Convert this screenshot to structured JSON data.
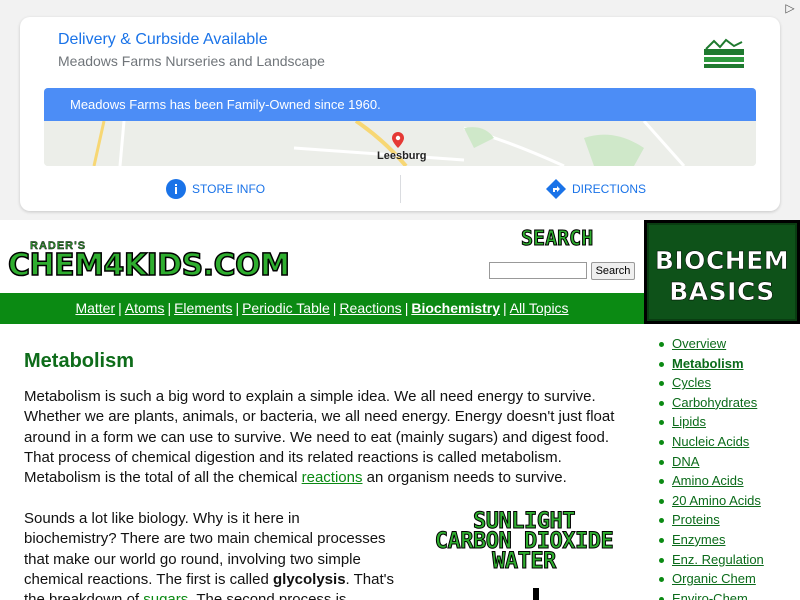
{
  "ad": {
    "close_label": "▷",
    "headline": "Delivery & Curbside Available",
    "advertiser": "Meadows Farms Nurseries and Landscape",
    "banner_text": "Meadows Farms has been Family-Owned since 1960.",
    "map_city": "Leesburg",
    "store_info_label": "STORE INFO",
    "directions_label": "DIRECTIONS",
    "accent_color": "#1a73e8",
    "banner_color": "#4c8df6"
  },
  "header": {
    "logo_small": "RADER'S",
    "logo_main": "CHEM4KIDS.COM",
    "search_title": "SEARCH",
    "search_value": "",
    "search_button": "Search"
  },
  "nav": {
    "items": [
      {
        "label": "Matter",
        "current": false
      },
      {
        "label": "Atoms",
        "current": false
      },
      {
        "label": "Elements",
        "current": false
      },
      {
        "label": "Periodic Table",
        "current": false
      },
      {
        "label": "Reactions",
        "current": false
      },
      {
        "label": "Biochemistry",
        "current": true
      },
      {
        "label": "All Topics",
        "current": false
      }
    ],
    "separator": "|",
    "bg_color": "#0b8a13"
  },
  "section_badge": {
    "line1": "BIOCHEM",
    "line2": "BASICS"
  },
  "side_nav": {
    "items": [
      {
        "label": "Overview",
        "active": false
      },
      {
        "label": "Metabolism",
        "active": true
      },
      {
        "label": "Cycles",
        "active": false
      },
      {
        "label": "Carbohydrates",
        "active": false
      },
      {
        "label": "Lipids",
        "active": false
      },
      {
        "label": "Nucleic Acids",
        "active": false
      },
      {
        "label": "DNA",
        "active": false
      },
      {
        "label": "Amino Acids",
        "active": false
      },
      {
        "label": "20 Amino Acids",
        "active": false
      },
      {
        "label": "Proteins",
        "active": false
      },
      {
        "label": "Enzymes",
        "active": false
      },
      {
        "label": "Enz. Regulation",
        "active": false
      },
      {
        "label": "Organic Chem",
        "active": false
      },
      {
        "label": "Enviro-Chem",
        "active": false
      }
    ]
  },
  "main": {
    "title": "Metabolism",
    "p1_before": "Metabolism is such a big word to explain a simple idea. We all need energy to survive. Whether we are plants, animals, or bacteria, we all need energy. Energy doesn't just float around in a form we can use to survive. We need to eat (mainly sugars) and digest food. That process of chemical digestion and its related reactions is called metabolism. Metabolism is the total of all the chemical ",
    "p1_link": "reactions",
    "p1_after": " an organism needs to survive.",
    "p2_before": "Sounds a lot like biology. Why is it here in biochemistry? There are two main chemical processes that make our world go round, involving two simple chemical reactions. The first is called ",
    "p2_bold": "glycolysis",
    "p2_mid": ". That's the breakdown of ",
    "p2_link": "sugars",
    "p2_after": ". The second process is",
    "diagram_lines": [
      "SUNLIGHT",
      "CARBON DIOXIDE",
      "WATER"
    ],
    "title_color": "#0e6c1a",
    "link_color": "#0b8a13"
  }
}
